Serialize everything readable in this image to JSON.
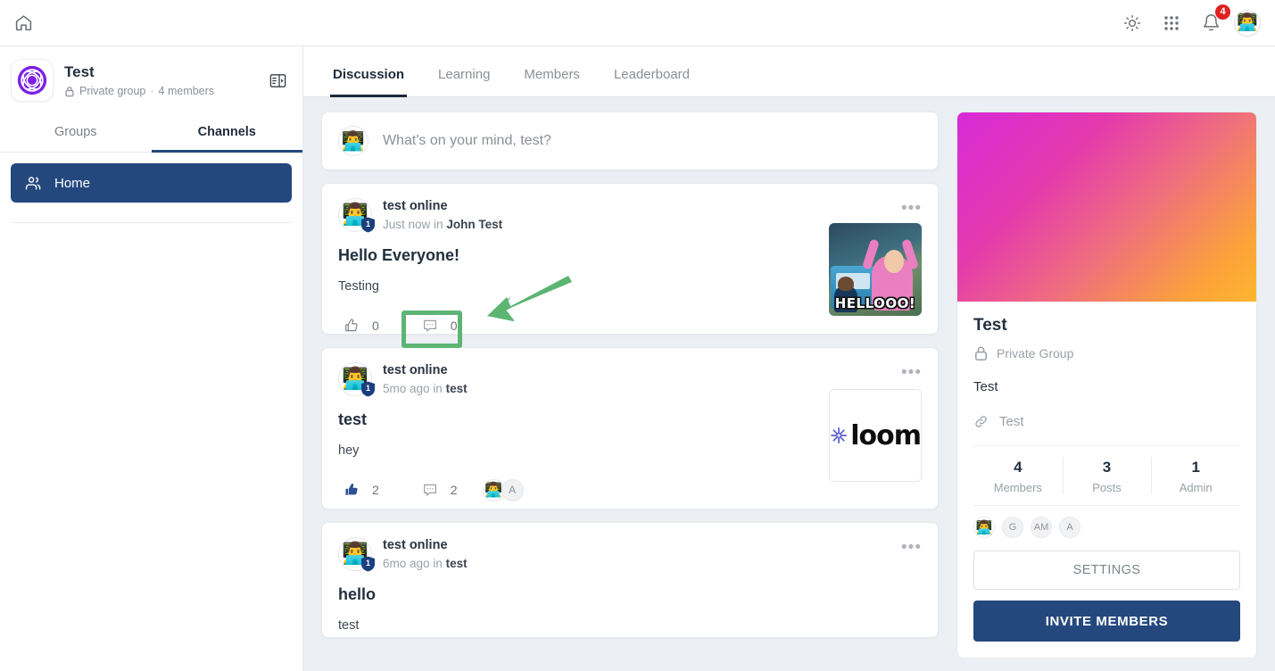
{
  "topbar": {
    "home_icon": "home-icon",
    "theme_icon": "sun-icon",
    "apps_icon": "grid-apps-icon",
    "notifications_icon": "bell-icon",
    "notifications_count": "4",
    "avatar_emoji": "👨‍💻"
  },
  "sidebar": {
    "group_name": "Test",
    "privacy": "Private group",
    "separator": "·",
    "members": "4 members",
    "collapse_icon": "panel-collapse-icon",
    "tabs": [
      {
        "label": "Groups",
        "active": false
      },
      {
        "label": "Channels",
        "active": true
      }
    ],
    "channels": [
      {
        "label": "Home",
        "icon": "people-icon",
        "active": true
      }
    ]
  },
  "main": {
    "tabs": [
      {
        "label": "Discussion",
        "active": true
      },
      {
        "label": "Learning",
        "active": false
      },
      {
        "label": "Members",
        "active": false
      },
      {
        "label": "Leaderboard",
        "active": false
      }
    ],
    "composer": {
      "avatar_emoji": "👨‍💻",
      "placeholder": "What's on your mind, test?"
    },
    "posts": [
      {
        "author": "test online",
        "avatar_emoji": "👨‍💻",
        "badge": "1",
        "time": "Just now",
        "in_label": "in",
        "channel": "John Test",
        "title": "Hello Everyone!",
        "body": "Testing",
        "likes": "0",
        "comments": "0",
        "liked": false,
        "thumb_type": "gif",
        "thumb_caption": "HELLOOO!",
        "more_icon": "more-options-icon"
      },
      {
        "author": "test online",
        "avatar_emoji": "👨‍💻",
        "badge": "1",
        "time": "5mo ago",
        "in_label": "in",
        "channel": "test",
        "title": "test",
        "body": "hey",
        "likes": "2",
        "comments": "2",
        "liked": true,
        "thumb_type": "loom",
        "thumb_caption": "loom",
        "more_icon": "more-options-icon",
        "reactors": [
          {
            "type": "emoji",
            "value": "👨‍💻"
          },
          {
            "type": "initials",
            "value": "A"
          }
        ]
      },
      {
        "author": "test online",
        "avatar_emoji": "👨‍💻",
        "badge": "1",
        "time": "6mo ago",
        "in_label": "in",
        "channel": "test",
        "title": "hello",
        "body": "test",
        "more_icon": "more-options-icon"
      }
    ]
  },
  "rail": {
    "banner_gradient_from": "#d72bd8",
    "banner_gradient_to": "#ffb62f",
    "title": "Test",
    "privacy": "Private Group",
    "privacy_icon": "lock-icon",
    "description": "Test",
    "link_icon": "link-icon",
    "link_text": "Test",
    "stats": [
      {
        "value": "4",
        "label": "Members"
      },
      {
        "value": "3",
        "label": "Posts"
      },
      {
        "value": "1",
        "label": "Admin"
      }
    ],
    "member_avatars": [
      {
        "type": "emoji",
        "value": "👨‍💻"
      },
      {
        "type": "initials",
        "value": "G"
      },
      {
        "type": "initials",
        "value": "AM"
      },
      {
        "type": "initials",
        "value": "A"
      }
    ],
    "settings_label": "SETTINGS",
    "invite_label": "INVITE MEMBERS"
  },
  "annotation": {
    "highlight_target": "comment-button-post-1",
    "color": "#5cb573"
  }
}
